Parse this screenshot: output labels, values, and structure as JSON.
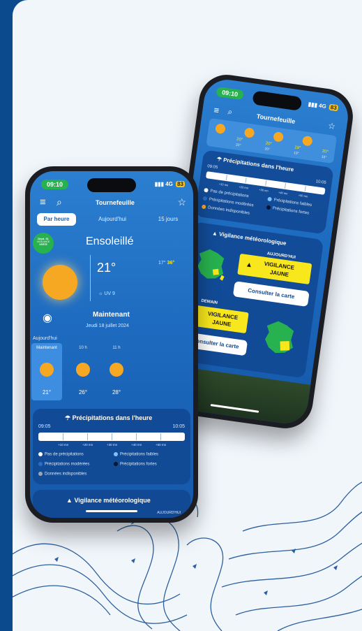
{
  "colors": {
    "frame": "#0b4a8c",
    "card": "#f1f6fb",
    "screen": "#1d6bc0",
    "accent_green": "#27b14f",
    "vigilance_yellow": "#f8e71c",
    "sun": "#f7a823"
  },
  "back_phone": {
    "status": {
      "time": "09:10",
      "network": "4G",
      "battery": "83"
    },
    "header": {
      "city": "Tournefeuille"
    },
    "forecast_strip": [
      {
        "temp": "20°",
        "sub": "20°"
      },
      {
        "temp": "20°",
        "sub": "20°"
      },
      {
        "temp": "19°",
        "sub": "19°"
      },
      {
        "temp": "20°",
        "sub": "15°"
      }
    ],
    "precip": {
      "title": "Précipitations dans l'heure",
      "start": "09:05",
      "end": "10:05",
      "ticks": [
        "+10 mn",
        "+20 mn",
        "+30 mn",
        "+40 mn",
        "+50 mn"
      ],
      "legend": [
        "Pas de précipitations",
        "Précipitations faibles",
        "Précipitations modérées",
        "Précipitations fortes",
        "Données indisponibles"
      ]
    },
    "vigilance": {
      "title": "Vigilance météorologique",
      "today_label": "AUJOURD'HUI",
      "badge_line1": "VIGILANCE",
      "badge_line2": "JAUNE",
      "button": "Consulter la carte",
      "tomorrow_label": "DEMAIN"
    }
  },
  "front_phone": {
    "status": {
      "time": "09:10",
      "network": "4G",
      "battery": "83"
    },
    "header": {
      "city": "Tournefeuille"
    },
    "tabs": [
      "Par heure",
      "Aujourd'hui",
      "15 jours"
    ],
    "badge": {
      "line1": "Dept. 31",
      "line2": "VIGILANCE",
      "line3": "VERTE"
    },
    "condition": "Ensoleillé",
    "temp_now": "21°",
    "temp_min": "17°",
    "temp_max": "36°",
    "uv": "UV 9",
    "now_label": "Maintenant",
    "date": "Jeudi 18 juillet 2024",
    "today_label": "Aujourd'hui",
    "hourly": [
      {
        "label": "Maintenant",
        "temp": "21°"
      },
      {
        "label": "10 h",
        "temp": "26°"
      },
      {
        "label": "11 h",
        "temp": "28°"
      }
    ],
    "precip": {
      "title": "Précipitations dans l'heure",
      "start": "09:05",
      "end": "10:05",
      "ticks": [
        "+10 mn",
        "+20 mn",
        "+30 mn",
        "+40 mn",
        "+50 mn"
      ],
      "legend": [
        "Pas de précipitations",
        "Précipitations faibles",
        "Précipitations modérées",
        "Précipitations fortes",
        "Données indisponibles"
      ]
    },
    "vigilance_title": "Vigilance météorologique",
    "peek_label": "AUJOURD'HUI"
  }
}
